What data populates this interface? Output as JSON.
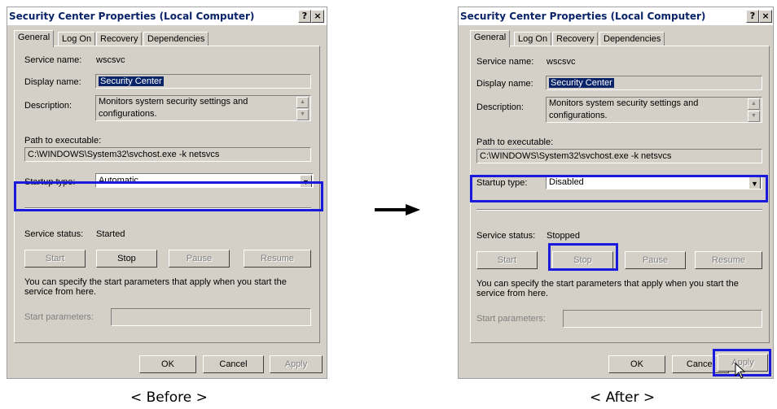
{
  "before": {
    "title": "Security Center Properties (Local Computer)",
    "help_btn": "?",
    "close_btn": "×",
    "tabs": [
      "General",
      "Log On",
      "Recovery",
      "Dependencies"
    ],
    "service_name_label": "Service name:",
    "service_name_value": "wscsvc",
    "display_name_label": "Display name:",
    "display_name_value": "Security Center",
    "description_label": "Description:",
    "description_value": "Monitors system security settings and configurations.",
    "path_label": "Path to executable:",
    "path_value": "C:\\WINDOWS\\System32\\svchost.exe -k netsvcs",
    "startup_label": "Startup type:",
    "startup_value": "Automatic",
    "status_label": "Service status:",
    "status_value": "Started",
    "buttons": {
      "start": "Start",
      "stop": "Stop",
      "pause": "Pause",
      "resume": "Resume"
    },
    "hint": "You can specify the start parameters that apply when you start the service from here.",
    "params_label": "Start parameters:",
    "ok": "OK",
    "cancel": "Cancel",
    "apply": "Apply",
    "caption": "< Before >"
  },
  "after": {
    "title": "Security Center Properties (Local Computer)",
    "help_btn": "?",
    "close_btn": "×",
    "tabs": [
      "General",
      "Log On",
      "Recovery",
      "Dependencies"
    ],
    "service_name_label": "Service name:",
    "service_name_value": "wscsvc",
    "display_name_label": "Display name:",
    "display_name_value": "Security Center",
    "description_label": "Description:",
    "description_value": "Monitors system security settings and configurations.",
    "path_label": "Path to executable:",
    "path_value": "C:\\WINDOWS\\System32\\svchost.exe -k netsvcs",
    "startup_label": "Startup type:",
    "startup_value": "Disabled",
    "status_label": "Service status:",
    "status_value": "Stopped",
    "buttons": {
      "start": "Start",
      "stop": "Stop",
      "pause": "Pause",
      "resume": "Resume"
    },
    "hint": "You can specify the start parameters that apply when you start the service from here.",
    "params_label": "Start parameters:",
    "ok": "OK",
    "cancel": "Cancel",
    "apply": "Apply",
    "caption": "< After >"
  },
  "colors": {
    "highlight": "#1a1adf",
    "dialog_bg": "#d4d0c8",
    "title_text": "#0a246a"
  },
  "icons": {
    "arrow": "right-arrow-icon",
    "cursor": "mouse-cursor-icon"
  }
}
